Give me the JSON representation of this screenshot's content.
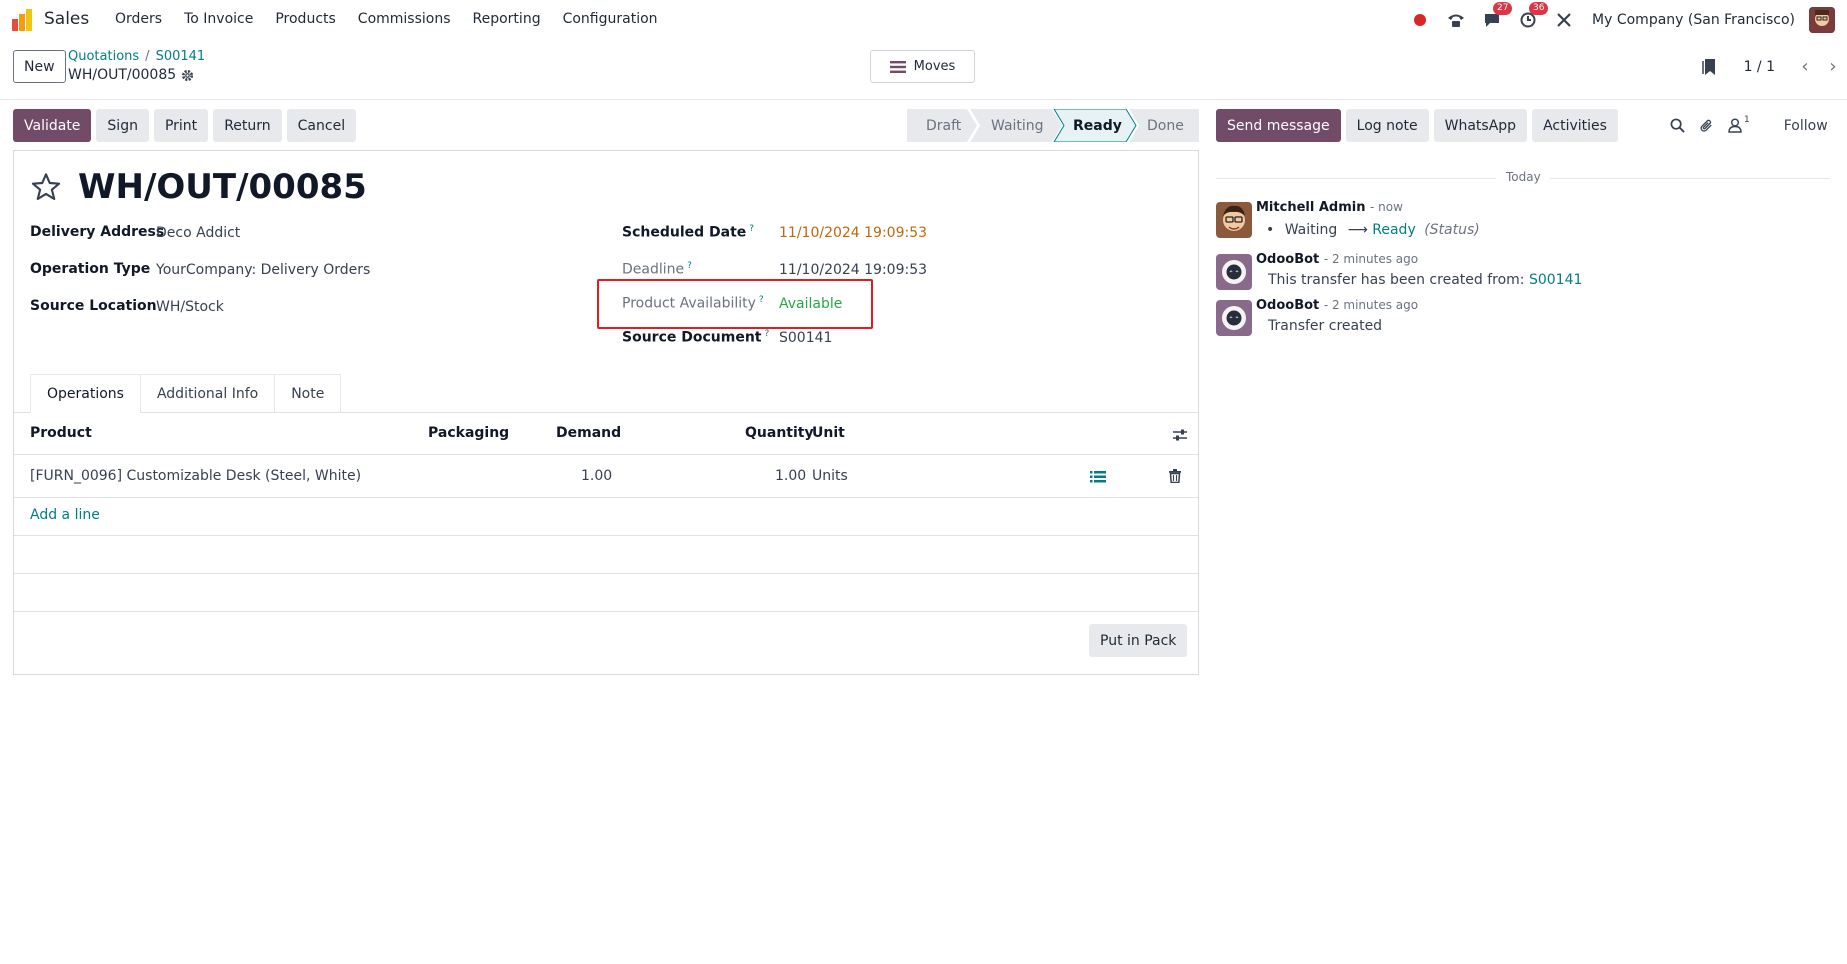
{
  "navbar": {
    "app_name": "Sales",
    "menu": [
      "Orders",
      "To Invoice",
      "Products",
      "Commissions",
      "Reporting",
      "Configuration"
    ],
    "messages_count": "27",
    "activities_count": "36",
    "company": "My Company (San Francisco)"
  },
  "control": {
    "new_label": "New",
    "breadcrumb_root": "Quotations",
    "breadcrumb_separator": "/",
    "breadcrumb_parent": "S00141",
    "record_name": "WH/OUT/00085",
    "moves_label": "Moves",
    "pager": "1 / 1"
  },
  "buttons": {
    "validate": "Validate",
    "sign": "Sign",
    "print": "Print",
    "return": "Return",
    "cancel": "Cancel",
    "put_in_pack": "Put in Pack"
  },
  "statusbar": {
    "stages": [
      "Draft",
      "Waiting",
      "Ready",
      "Done"
    ],
    "active": "Ready"
  },
  "form": {
    "title": "WH/OUT/00085",
    "delivery_address_label": "Delivery Address",
    "delivery_address": "Deco Addict",
    "operation_type_label": "Operation Type",
    "operation_type": "YourCompany: Delivery Orders",
    "source_location_label": "Source Location",
    "source_location": "WH/Stock",
    "scheduled_date_label": "Scheduled Date",
    "scheduled_date": "11/10/2024 19:09:53",
    "deadline_label": "Deadline",
    "deadline": "11/10/2024 19:09:53",
    "product_availability_label": "Product Availability",
    "product_availability": "Available",
    "source_document_label": "Source Document",
    "source_document": "S00141",
    "help_mark": "?"
  },
  "tabs": [
    "Operations",
    "Additional Info",
    "Note"
  ],
  "table": {
    "headers": {
      "product": "Product",
      "packaging": "Packaging",
      "demand": "Demand",
      "quantity": "Quantity",
      "unit": "Unit"
    },
    "rows": [
      {
        "product": "[FURN_0096] Customizable Desk (Steel, White)",
        "packaging": "",
        "demand": "1.00",
        "quantity": "1.00",
        "unit": "Units"
      }
    ],
    "add_line": "Add a line"
  },
  "chatter": {
    "send_message": "Send message",
    "log_note": "Log note",
    "whatsapp": "WhatsApp",
    "activities": "Activities",
    "followers_count": "1",
    "follow": "Follow",
    "date_separator": "Today",
    "messages": [
      {
        "author": "Mitchell Admin",
        "time": "- now",
        "old_status": "Waiting",
        "arrow": "⟶",
        "new_status": "Ready",
        "field": "(Status)"
      },
      {
        "author": "OdooBot",
        "time": "- 2 minutes ago",
        "body": "This transfer has been created from:",
        "link": "S00141"
      },
      {
        "author": "OdooBot",
        "time": "- 2 minutes ago",
        "body": "Transfer created"
      }
    ]
  },
  "colors": {
    "primary": "#714b67",
    "link": "#017e84",
    "highlight_box": "#e11d24",
    "available": "#28a745",
    "scheduled_date": "#c2660b"
  }
}
